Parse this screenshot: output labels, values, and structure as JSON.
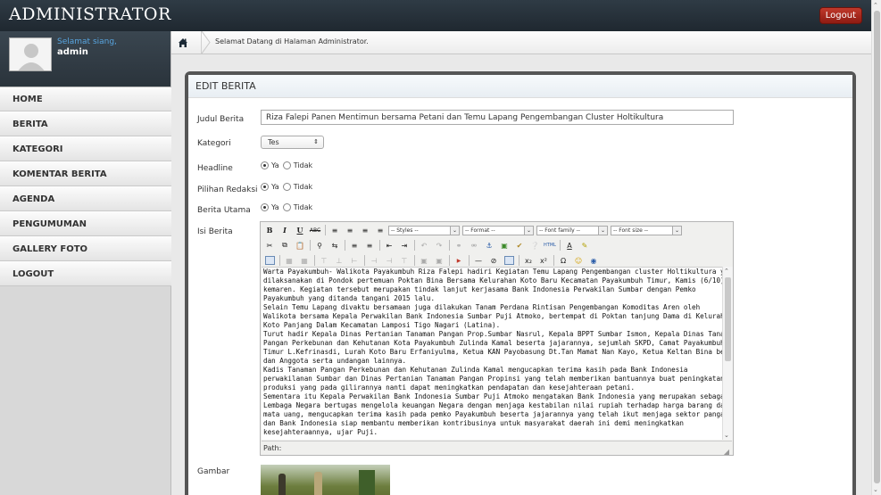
{
  "app": {
    "title": "ADMINISTRATOR",
    "logout_label": "Logout"
  },
  "user": {
    "greeting": "Selamat siang,",
    "name": "admin"
  },
  "menu": [
    {
      "label": "HOME"
    },
    {
      "label": "BERITA"
    },
    {
      "label": "KATEGORI"
    },
    {
      "label": "KOMENTAR BERITA"
    },
    {
      "label": "AGENDA"
    },
    {
      "label": "PENGUMUMAN"
    },
    {
      "label": "GALLERY FOTO"
    },
    {
      "label": "LOGOUT"
    }
  ],
  "breadcrumb": {
    "text": "Selamat Datang di Halaman Administrator."
  },
  "form": {
    "heading": "EDIT BERITA",
    "judul_label": "Judul Berita",
    "judul_value": "Riza Falepi Panen Mentimun bersama Petani dan Temu Lapang Pengembangan Cluster Holtikultura",
    "kategori_label": "Kategori",
    "kategori_value": "Tes",
    "headline_label": "Headline",
    "pilihan_label": "Pilihan Redaksi",
    "utama_label": "Berita Utama",
    "opt_ya": "Ya",
    "opt_tidak": "Tidak",
    "isi_label": "Isi Berita",
    "gambar_label": "Gambar"
  },
  "editor": {
    "styles": "-- Styles --",
    "format": "-- Format --",
    "font_family": "-- Font family --",
    "font_size": "-- Font size --",
    "path_label": "Path:",
    "lines": [
      "Warta Payakumbuh- Walikota Payakumbuh Riza Falepi hadiri Kegiatan Temu Lapang Pengembangan cluster Holtikultura yang",
      "dilaksanakan di Pondok pertemuan Poktan Bina Bersama Kelurahan Koto Baru Kecamatan Payakumbuh Timur, Kamis (6/10)",
      "kemaren. Kegiatan tersebut merupakan tindak lanjut kerjasama Bank Indonesia Perwakilan Sumbar dengan Pemko",
      "Payakumbuh yang ditanda tangani 2015 lalu.",
      "Selain Temu Lapang divaktu bersamaan juga dilakukan Tanam Perdana Rintisan Pengembangan Komoditas Aren oleh",
      "Walikota bersama Kepala Perwakilan Bank Indonesia Sumbar Puji Atmoko, bertempat di Poktan tanjung Dama di Kelurahan",
      "Koto Panjang Dalam Kecamatan Lamposi Tigo Nagari (Latina).",
      "Turut hadir Kepala Dinas Pertanian Tanaman Pangan Prop.Sumbar Nasrul, Kepala BPPT Sumbar Ismon, Kepala Dinas Tanaman",
      "Pangan Perkebunan dan Kehutanan Kota Payakumbuh Zulinda Kamal beserta jajarannya, sejumlah SKPD, Camat Payakumbuh",
      "Timur L.Kefrinasdi, Lurah Koto Baru Erfaniyulma, Ketua KAN Payobasung Dt.Tan Mamat Nan Kayo, Ketua Keltan Bina bersama",
      "dan Anggota serta undangan lainnya.",
      "Kadis Tanaman Pangan Perkebunan dan Kehutanan Zulinda Kamal mengucapkan terima kasih pada Bank Indonesia",
      "perwakilanan Sumbar dan Dinas Pertanian Tanaman Pangan Propinsi yang telah memberikan bantuannya buat peningkatan",
      "produksi yang pada gilirannya nanti dapat meningkatkan pendapatan dan kesejahteraan petani.",
      "Sementara itu Kepala Perwakilan Bank Indonesia Sumbar Puji Atmoko mengatakan Bank Indonesia yang merupakan sebagai",
      "Lembaga Negara bertugas mengelola keuangan Negara dengan menjaga kestabilan nilai rupiah terhadap harga barang dan",
      "mata uang, mengucapkan terima kasih pada pemko Payakumbuh beserta jajarannya yang telah ikut menjaga sektor pangan",
      "dan Bank Indonesia siap membantu memberikan kontribusinya untuk masyarakat daerah ini demi meningkatkan",
      "kesejahteraannya, ujar Puji."
    ]
  },
  "colors": {
    "topbar": "#27323b",
    "logout": "#b03024",
    "greeting": "#58a5e0"
  }
}
